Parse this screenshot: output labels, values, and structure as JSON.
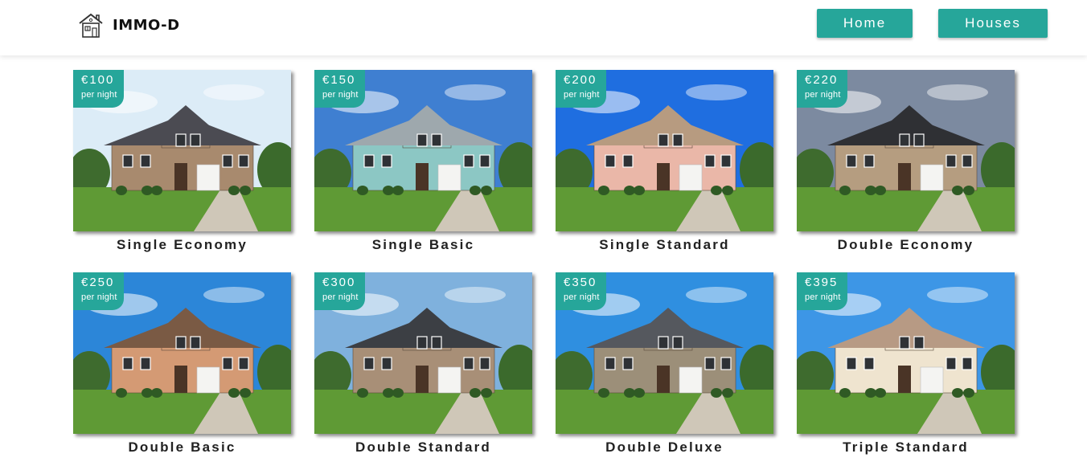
{
  "brand": {
    "name": "IMMO-D",
    "logo_icon": "house-icon"
  },
  "nav": {
    "home_label": "Home",
    "houses_label": "Houses"
  },
  "colors": {
    "accent": "#26a69a"
  },
  "houses": [
    {
      "title": "Single Economy",
      "price": "€100",
      "unit": "per night",
      "house_color": "#a88a6e",
      "roof_color": "#4b4b52",
      "sky": "#dcecf7"
    },
    {
      "title": "Single Basic",
      "price": "€150",
      "unit": "per night",
      "house_color": "#8cc7c4",
      "roof_color": "#9ea8ad",
      "sky": "#3f7fd1"
    },
    {
      "title": "Single Standard",
      "price": "€200",
      "unit": "per night",
      "house_color": "#eab7a8",
      "roof_color": "#b79b80",
      "sky": "#1f6ee0"
    },
    {
      "title": "Double Economy",
      "price": "€220",
      "unit": "per night",
      "house_color": "#b59d80",
      "roof_color": "#2f3034",
      "sky": "#7c8aa0"
    },
    {
      "title": "Double Basic",
      "price": "€250",
      "unit": "per night",
      "house_color": "#d49a74",
      "roof_color": "#7a5a44",
      "sky": "#2c86d8"
    },
    {
      "title": "Double Standard",
      "price": "€300",
      "unit": "per night",
      "house_color": "#a88f77",
      "roof_color": "#3c3f44",
      "sky": "#7fb1dd"
    },
    {
      "title": "Double Deluxe",
      "price": "€350",
      "unit": "per night",
      "house_color": "#9c8f79",
      "roof_color": "#55585e",
      "sky": "#2f8fe0"
    },
    {
      "title": "Triple Standard",
      "price": "€395",
      "unit": "per night",
      "house_color": "#efe4cf",
      "roof_color": "#b79a84",
      "sky": "#3d96e6"
    }
  ]
}
